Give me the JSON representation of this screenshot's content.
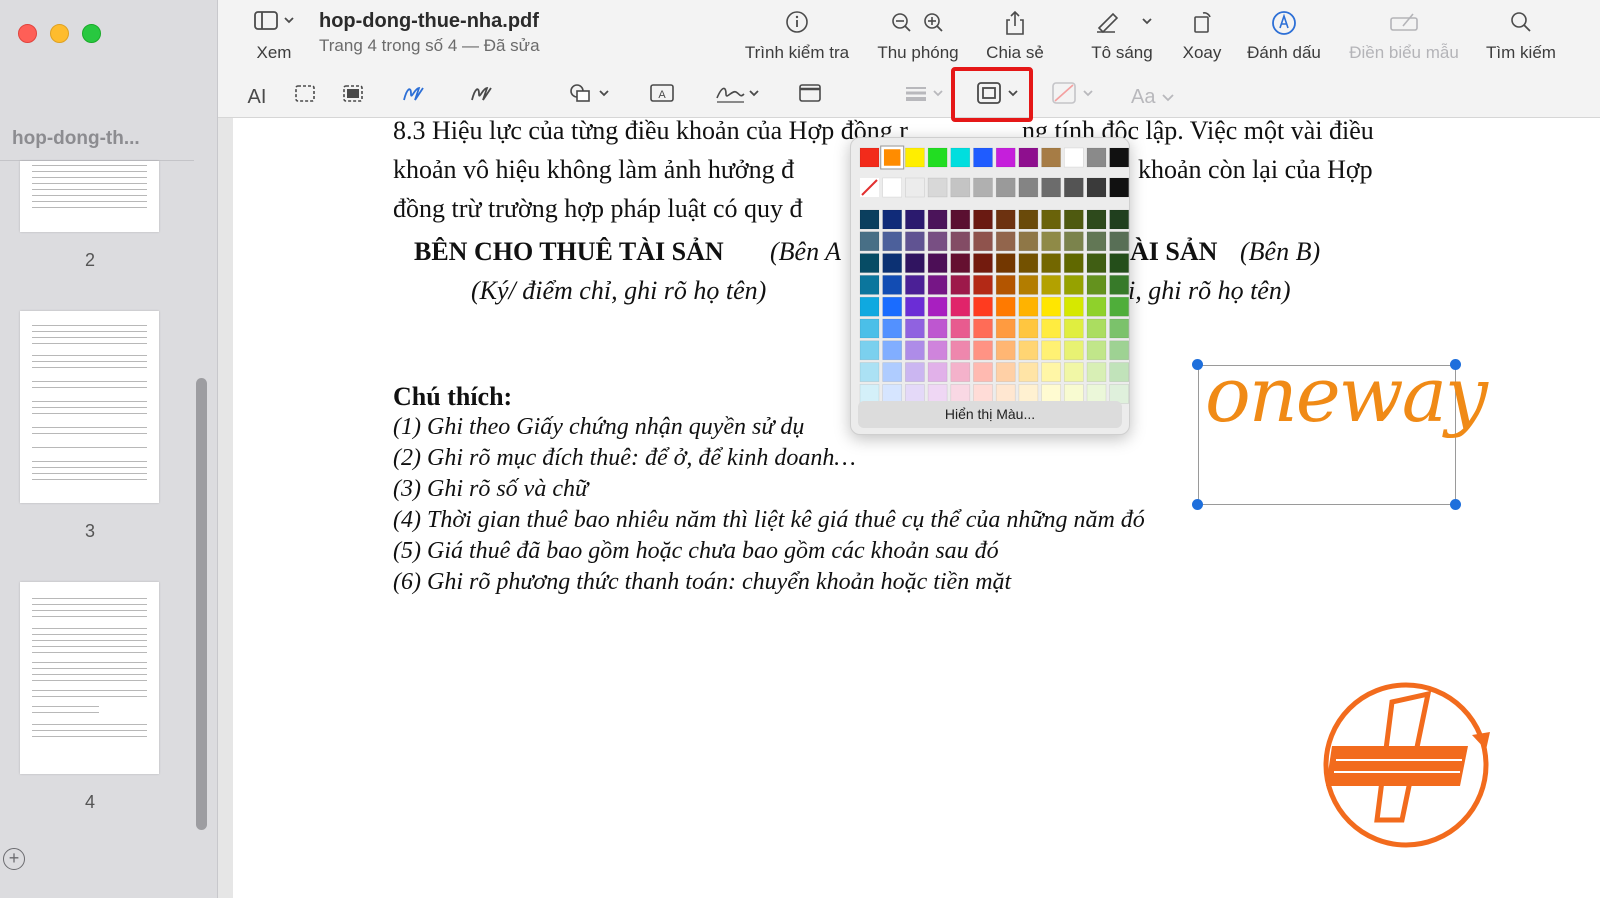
{
  "window": {
    "doc_title": "hop-dong-thue-nha.pdf",
    "doc_subtitle": "Trang 4 trong số 4 — Đã sửa"
  },
  "sidebar": {
    "doc_name": "hop-dong-th...",
    "pages": [
      "2",
      "3",
      "4"
    ],
    "add_icon": "plus-circle-icon"
  },
  "toolbar": {
    "view_label": "Xem",
    "inspector_label": "Trình kiểm tra",
    "zoom_label": "Thu phóng",
    "share_label": "Chia sẻ",
    "highlight_label": "Tô sáng",
    "rotate_label": "Xoay",
    "markup_label": "Đánh dấu",
    "fill_form_label": "Điền biểu mẫu",
    "search_label": "Tìm kiếm"
  },
  "markup_toolbar": {
    "text_tool": "AI",
    "text_style": "Aa"
  },
  "color_popup": {
    "show_colors_label": "Hiển thị Màu...",
    "selected_color": "#ff8c00"
  },
  "document": {
    "para_8_3_line1": "8.3 Hiệu lực của từng điều khoản của Hợp đồng r",
    "para_8_3_line1_end": "ng tính độc lập. Việc một vài điều",
    "para_8_3_line2": "khoản vô hiệu không làm ảnh hưởng đ",
    "para_8_3_line2_end": "khoản còn lại của Hợp",
    "para_8_3_line3": "đồng trừ trường hợp pháp luật có quy đ",
    "party_a_bold": "BÊN CHO THUÊ TÀI SẢN",
    "party_a_ital": "(Bên A",
    "party_b_bold": "ÀI SẢN",
    "party_b_ital": "(Bên B)",
    "sign_a": "(Ký/ điểm chỉ, ghi rõ họ tên)",
    "sign_b": "i, ghi rõ họ tên)",
    "notes_heading": "Chú thích:",
    "notes": [
      "(1) Ghi theo Giấy chứng nhận quyền sử dụ",
      "(2) Ghi rõ mục đích thuê: để ở, để kinh doanh…",
      "(3) Ghi rõ số và chữ",
      "(4) Thời gian thuê bao nhiêu năm thì liệt kê giá thuê cụ thể của những năm đó",
      "(5) Giá thuê đã bao gồm hoặc chưa bao gồm các khoản sau đó",
      "(6) Ghi rõ phương thức thanh toán: chuyển khoản hoặc tiền mặt"
    ],
    "signature": "oneway"
  },
  "colors": {
    "accent_blue": "#1e6fdc",
    "signature_orange": "#f08a16",
    "callout_red": "#e51717",
    "logo_orange": "#f26b1d"
  }
}
